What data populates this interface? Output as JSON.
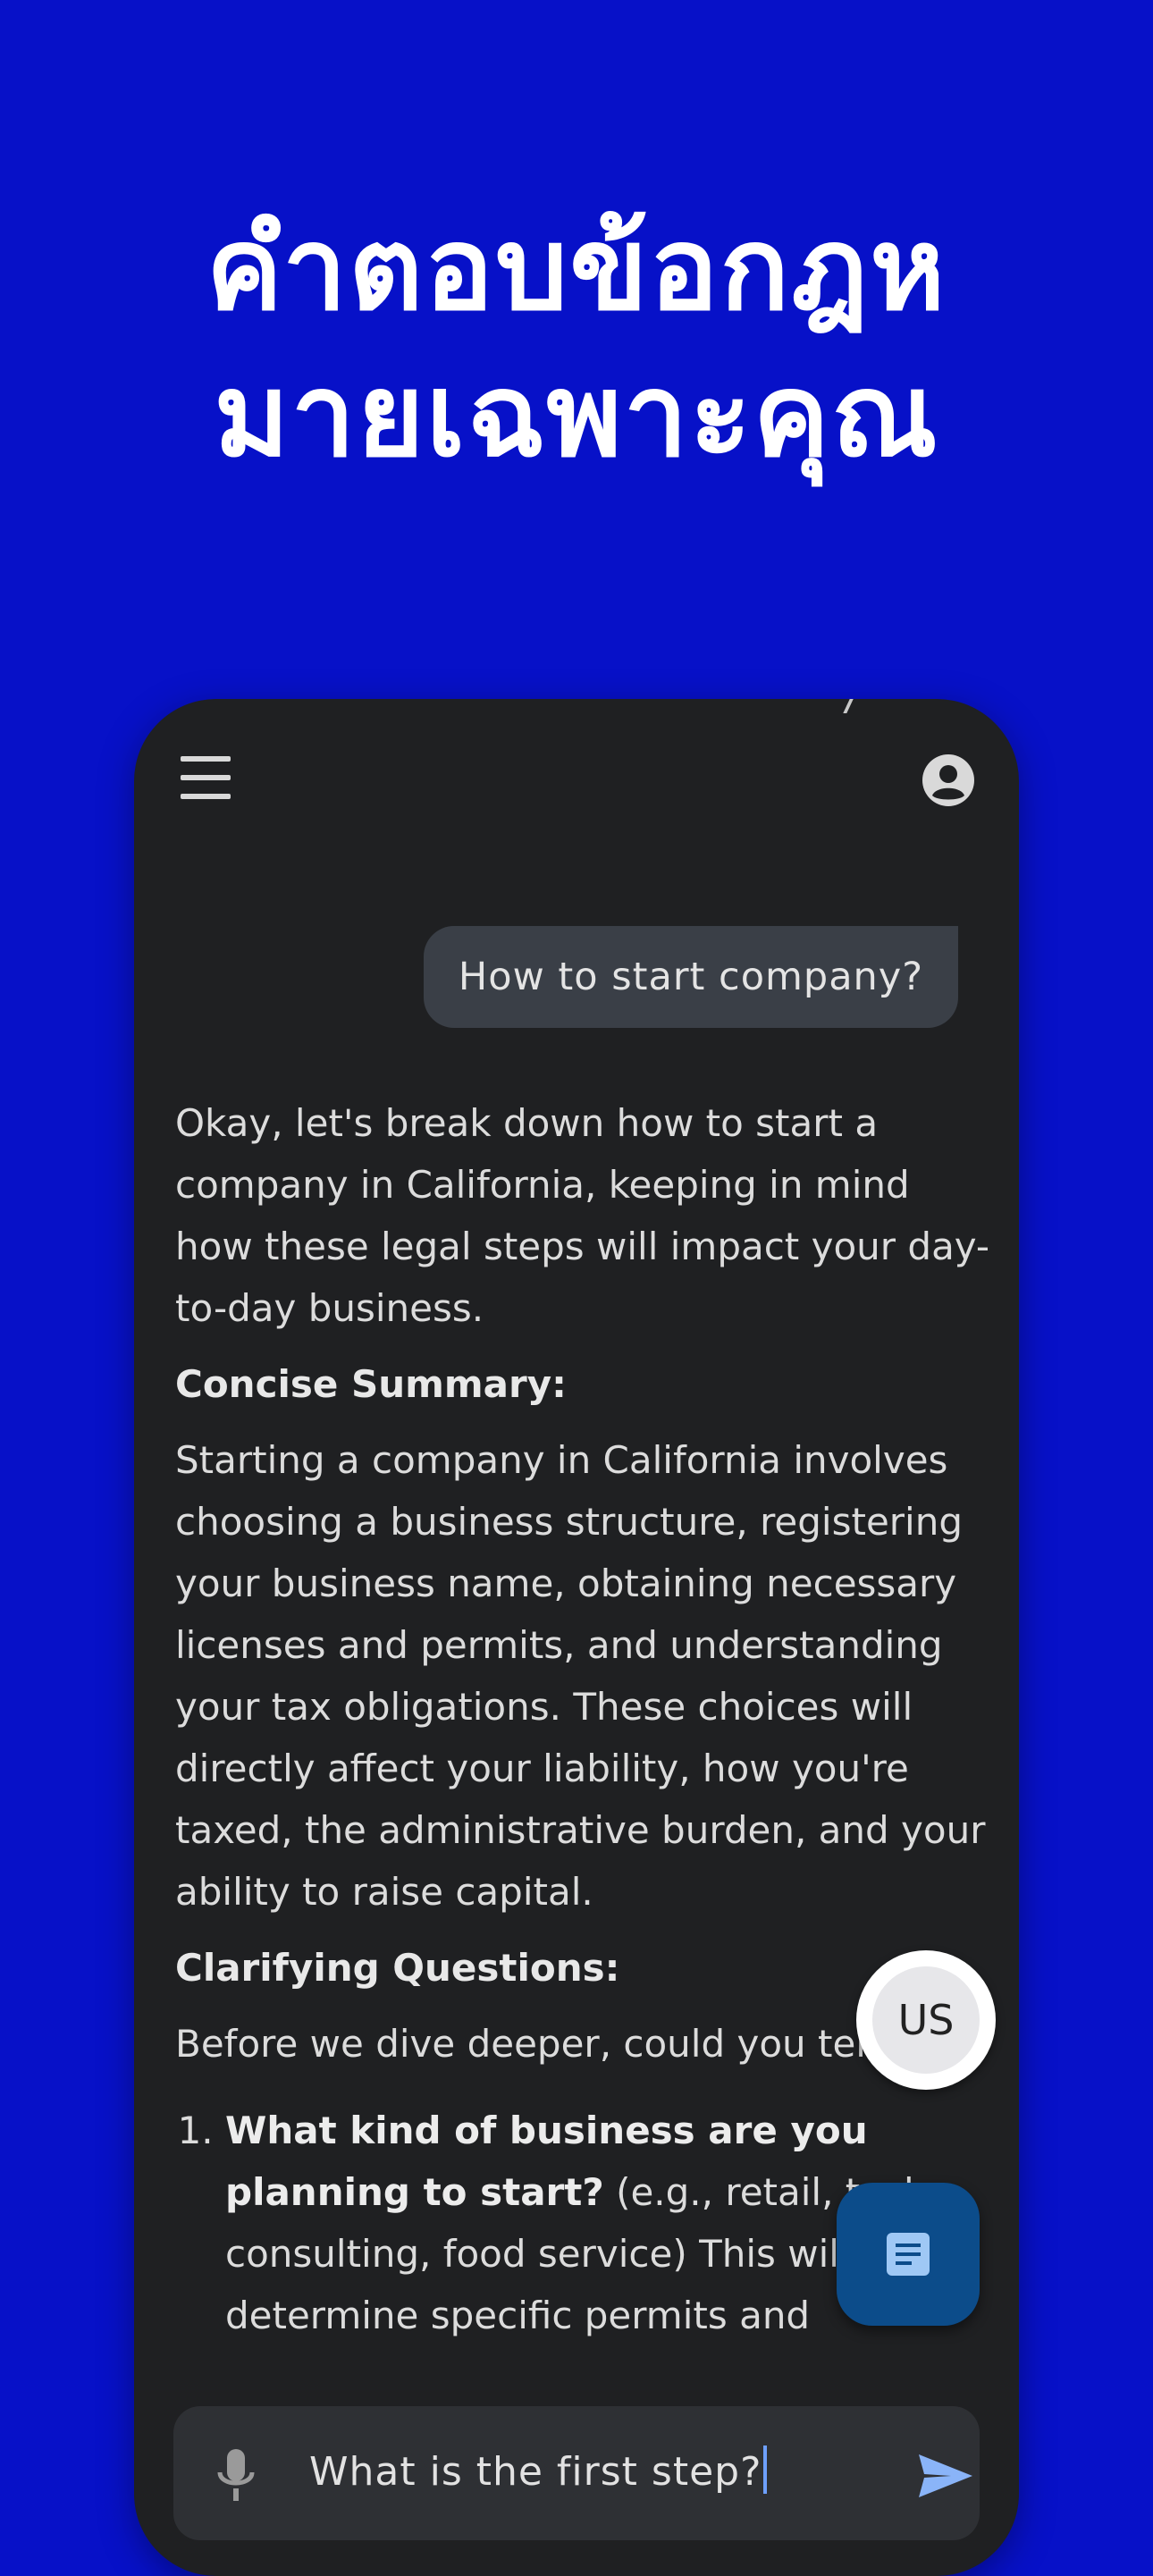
{
  "headline": {
    "line1": "คำตอบข้อกฎห",
    "line2": "มายเฉพาะคุณ"
  },
  "app": {
    "menu_icon": "hamburger-menu-icon",
    "account_icon": "account-circle-icon",
    "user_message": "How to start company?",
    "answer": {
      "intro": "Okay, let's break down how to start a company in California, keeping in mind how these legal steps will impact your day-to-day business.",
      "summary_heading": "Concise Summary:",
      "summary_text": "Starting a company in California involves choosing a business structure, registering your business name, obtaining necessary licenses and permits, and understanding your tax obligations. These choices will directly affect your liability, how you're taxed, the administrative burden, and your ability to raise capital.",
      "questions_heading": "Clarifying Questions:",
      "questions_intro": "Before we dive deeper, could you tell me:",
      "questions": [
        {
          "bold": "What kind of business are you planning to start?",
          "rest": " (e.g., retail, tech, consulting, food service) This will help determine specific permits and"
        }
      ]
    },
    "jurisdiction_badge": "US",
    "doc_icon": "document-icon",
    "input": {
      "mic_icon": "microphone-icon",
      "value": "What is the first step?",
      "send_icon": "send-icon"
    },
    "colors": {
      "background": "#0711c8",
      "phone": "#1f2022",
      "user_bubble": "#3a3f47",
      "doc_fab": "#0c4c8a",
      "send": "#8ab4f8"
    }
  }
}
